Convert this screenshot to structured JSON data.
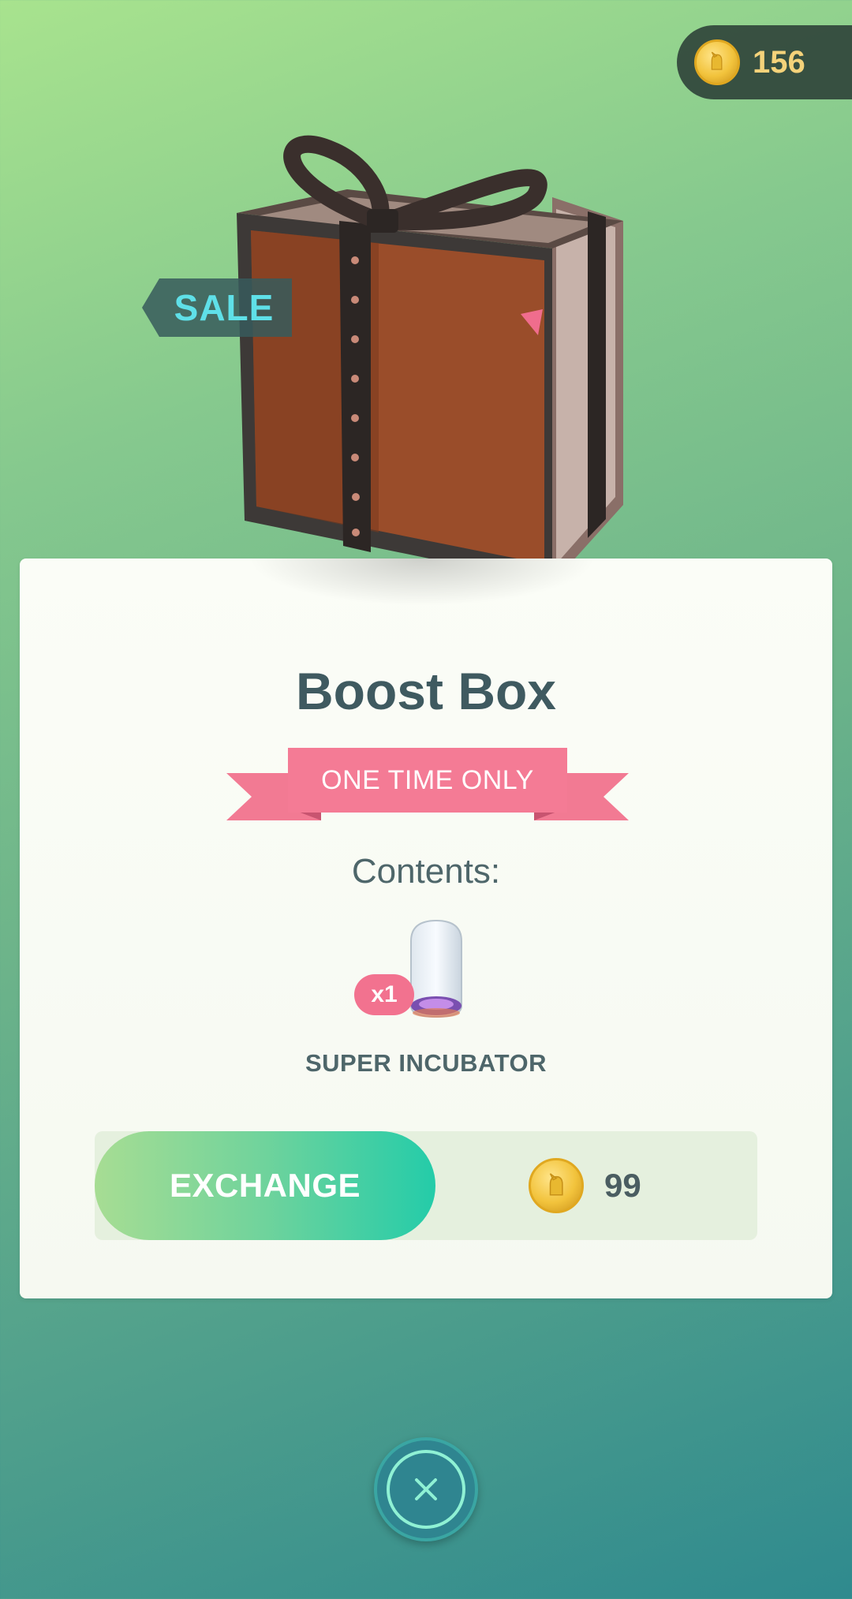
{
  "balance": {
    "coins": "156",
    "icon": "pokecoin-icon"
  },
  "sale_tag": "SALE",
  "product": {
    "name": "Boost Box",
    "banner": "ONE TIME ONLY",
    "contents_label": "Contents:",
    "items": [
      {
        "name": "SUPER INCUBATOR",
        "quantity": "x1",
        "icon": "super-incubator-icon"
      }
    ]
  },
  "exchange": {
    "button_label": "EXCHANGE",
    "price": "99",
    "currency_icon": "pokecoin-icon"
  },
  "close": {
    "icon": "close-icon"
  },
  "colors": {
    "accent_pink": "#f47b95",
    "exchange_gradient_start": "#a7dd93",
    "exchange_gradient_end": "#24cca9",
    "title_text": "#3f5a60",
    "coin_gold": "#f2c33c"
  }
}
